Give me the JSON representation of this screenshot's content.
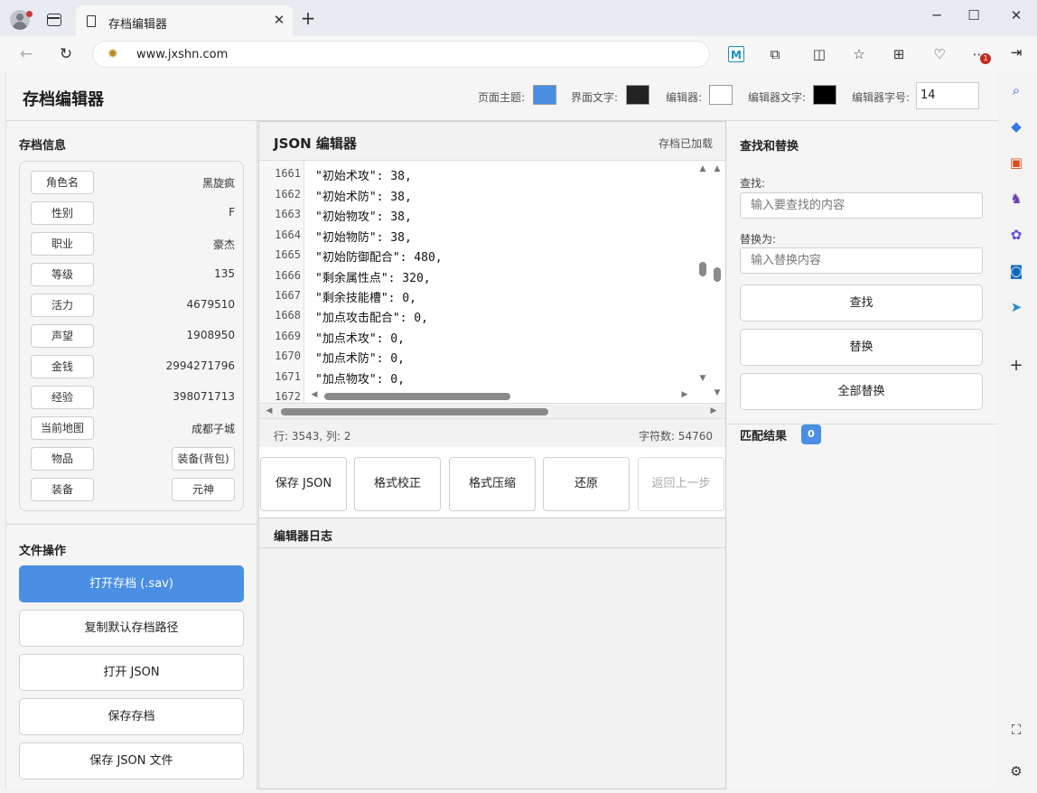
{
  "browser": {
    "tab_title": "存档编辑器",
    "url": "www.jxshn.com",
    "extension_badge": "1"
  },
  "app": {
    "title": "存档编辑器",
    "header": {
      "theme_label": "页面主题:",
      "ui_text_label": "界面文字:",
      "editor_label": "编辑器:",
      "editor_text_label": "编辑器文字:",
      "font_size_label": "编辑器字号:",
      "font_size_value": "14",
      "colors": {
        "theme": "#4a8fe3",
        "ui_text": "#222222",
        "editor": "#ffffff",
        "editor_text": "#000000"
      }
    },
    "save_info": {
      "title": "存档信息",
      "rows": [
        {
          "key": "角色名",
          "value": "黑旋疯"
        },
        {
          "key": "性别",
          "value": "F"
        },
        {
          "key": "职业",
          "value": "豪杰"
        },
        {
          "key": "等级",
          "value": "135"
        },
        {
          "key": "活力",
          "value": "4679510"
        },
        {
          "key": "声望",
          "value": "1908950"
        },
        {
          "key": "金钱",
          "value": "2994271796"
        },
        {
          "key": "经验",
          "value": "398071713"
        },
        {
          "key": "当前地图",
          "value": "成都子城"
        }
      ],
      "items_label": "物品",
      "items_button": "装备(背包)",
      "equip_label": "装备",
      "equip_button": "元神"
    },
    "file_ops": {
      "title": "文件操作",
      "open_save": "打开存档 (.sav)",
      "copy_path": "复制默认存档路径",
      "open_json": "打开 JSON",
      "save_archive": "保存存档",
      "save_json_file": "保存 JSON 文件"
    },
    "editor": {
      "title": "JSON 编辑器",
      "status": "存档已加载",
      "lines": [
        {
          "no": "1661",
          "text": "\"初始术攻\": 38,"
        },
        {
          "no": "1662",
          "text": "\"初始术防\": 38,"
        },
        {
          "no": "1663",
          "text": "\"初始物攻\": 38,"
        },
        {
          "no": "1664",
          "text": "\"初始物防\": 38,"
        },
        {
          "no": "1665",
          "text": "\"初始防御配合\": 480,"
        },
        {
          "no": "1666",
          "text": "\"剩余属性点\": 320,"
        },
        {
          "no": "1667",
          "text": "\"剩余技能槽\": 0,"
        },
        {
          "no": "1668",
          "text": "\"加点攻击配合\": 0,"
        },
        {
          "no": "1669",
          "text": "\"加点术攻\": 0,"
        },
        {
          "no": "1670",
          "text": "\"加点术防\": 0,"
        },
        {
          "no": "1671",
          "text": "\"加点物攻\": 0,"
        },
        {
          "no": "1672",
          "text": ""
        }
      ],
      "cursor": "行: 3543, 列: 2",
      "char_count": "字符数: 54760",
      "buttons": {
        "save_json": "保存 JSON",
        "validate": "格式校正",
        "minify": "格式压缩",
        "restore": "还原",
        "undo": "返回上一步"
      },
      "log_title": "编辑器日志"
    },
    "find_replace": {
      "title": "查找和替换",
      "find_label": "查找:",
      "find_placeholder": "输入要查找的内容",
      "replace_label": "替换为:",
      "replace_placeholder": "输入替换内容",
      "find_button": "查找",
      "replace_button": "替换",
      "replace_all_button": "全部替换",
      "results_label": "匹配结果",
      "results_count": "0"
    }
  }
}
